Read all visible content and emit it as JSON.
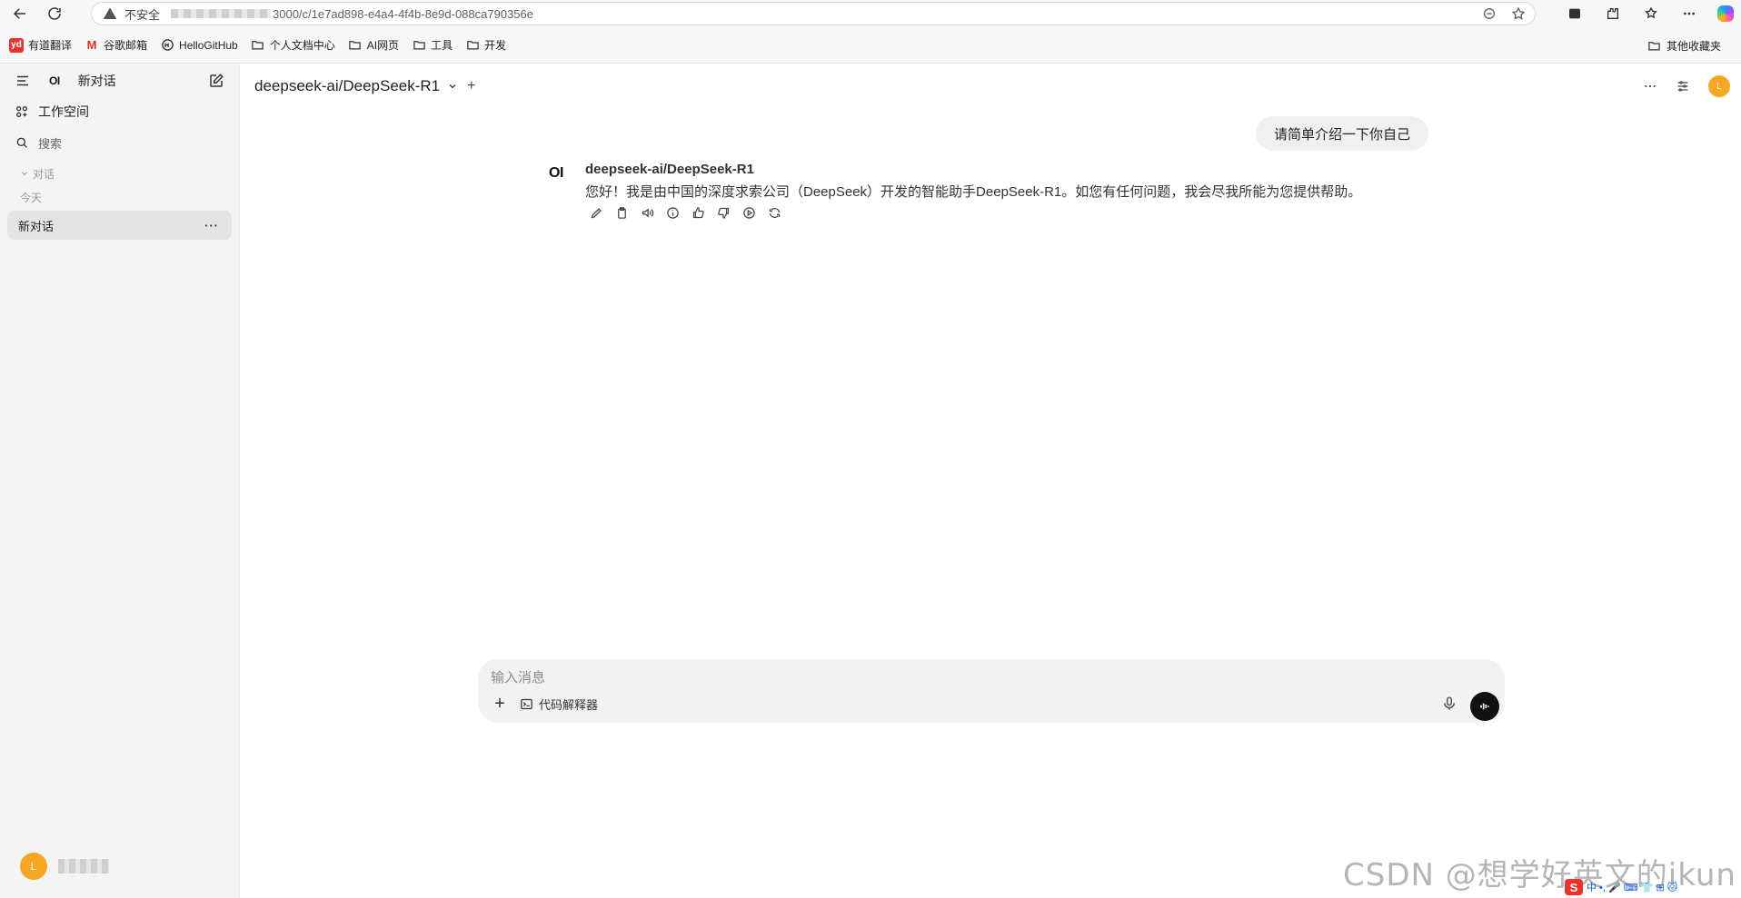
{
  "browser": {
    "insecure_label": "不安全",
    "url_tail": "3000/c/1e7ad898-e4a4-4f4b-8e9d-088ca790356e",
    "bookmarks": [
      {
        "label": "有道翻译",
        "icon": "youdao-icon"
      },
      {
        "label": "谷歌邮箱",
        "icon": "gmail-icon"
      },
      {
        "label": "HelloGitHub",
        "icon": "hellogithub-icon"
      },
      {
        "label": "个人文档中心",
        "icon": "folder-icon"
      },
      {
        "label": "AI网页",
        "icon": "folder-icon"
      },
      {
        "label": "工具",
        "icon": "folder-icon"
      },
      {
        "label": "开发",
        "icon": "folder-icon"
      }
    ],
    "other_bookmarks": "其他收藏夹"
  },
  "sidebar": {
    "logo": "OI",
    "title": "新对话",
    "workspace": "工作空间",
    "search": "搜索",
    "section": "对话",
    "group_today": "今天",
    "chats": [
      {
        "label": "新对话",
        "menu": "···"
      }
    ],
    "user_initial": "L"
  },
  "topbar": {
    "model": "deepseek-ai/DeepSeek-R1",
    "add": "+",
    "user_initial": "L"
  },
  "messages": {
    "user": "请简单介绍一下你自己",
    "assistant_logo": "OI",
    "assistant_name": "deepseek-ai/DeepSeek-R1",
    "assistant_text": "您好！我是由中国的深度求索公司（DeepSeek）开发的智能助手DeepSeek-R1。如您有任何问题，我会尽我所能为您提供帮助。"
  },
  "composer": {
    "placeholder": "输入消息",
    "plus": "+",
    "code_interpreter": "代码解释器"
  },
  "overlay": {
    "watermark": "CSDN @想学好英文的ikun",
    "ime_logo": "S",
    "ime_text": "中 •, 🎤 ⌨ 👕 ⊞ 🐱"
  },
  "colors": {
    "accent_avatar": "#f5a623",
    "sidebar_bg": "#f4f4f4",
    "selected_chat": "#e4e4e4",
    "bubble_bg": "#f0f0f0",
    "composer_bg": "#f2f2f2"
  }
}
